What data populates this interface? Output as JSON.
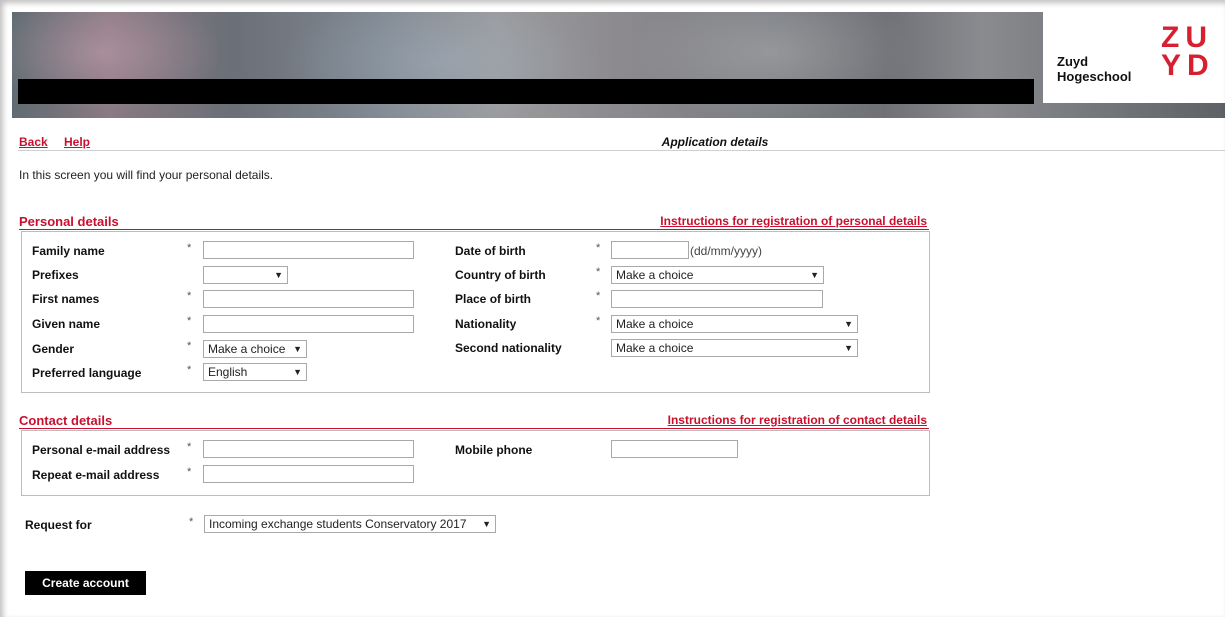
{
  "header": {
    "logo_line1": "Zuyd",
    "logo_line2": "Hogeschool",
    "logo_mark_top": "ZU",
    "logo_mark_bottom": "YD"
  },
  "nav": {
    "back": "Back",
    "help": "Help",
    "page_title": "Application details"
  },
  "intro": "In this screen you will find your personal details.",
  "personal": {
    "heading": "Personal details",
    "instructions_link": "Instructions for registration of personal details",
    "required_mark": "*",
    "family_name": {
      "label": "Family name",
      "value": ""
    },
    "prefixes": {
      "label": "Prefixes",
      "value": ""
    },
    "first_names": {
      "label": "First names",
      "value": ""
    },
    "given_name": {
      "label": "Given name",
      "value": ""
    },
    "gender": {
      "label": "Gender",
      "value": "Make a choice"
    },
    "preferred_language": {
      "label": "Preferred language",
      "value": "English"
    },
    "date_of_birth": {
      "label": "Date of birth",
      "value": "",
      "hint": "(dd/mm/yyyy)"
    },
    "country_of_birth": {
      "label": "Country of birth",
      "value": "Make a choice"
    },
    "place_of_birth": {
      "label": "Place of birth",
      "value": ""
    },
    "nationality": {
      "label": "Nationality",
      "value": "Make a choice"
    },
    "second_nationality": {
      "label": "Second nationality",
      "value": "Make a choice"
    }
  },
  "contact": {
    "heading": "Contact details",
    "instructions_link": "Instructions for registration of contact details",
    "email": {
      "label": "Personal e-mail address",
      "value": ""
    },
    "repeat_email": {
      "label": "Repeat e-mail address",
      "value": ""
    },
    "mobile": {
      "label": "Mobile phone",
      "value": ""
    }
  },
  "request": {
    "label": "Request for",
    "value": "Incoming exchange students Conservatory 2017"
  },
  "actions": {
    "create_account": "Create account"
  },
  "colors": {
    "accent": "#c8102e",
    "button": "#000000"
  },
  "icons": {
    "dropdown_arrow": "▼"
  }
}
